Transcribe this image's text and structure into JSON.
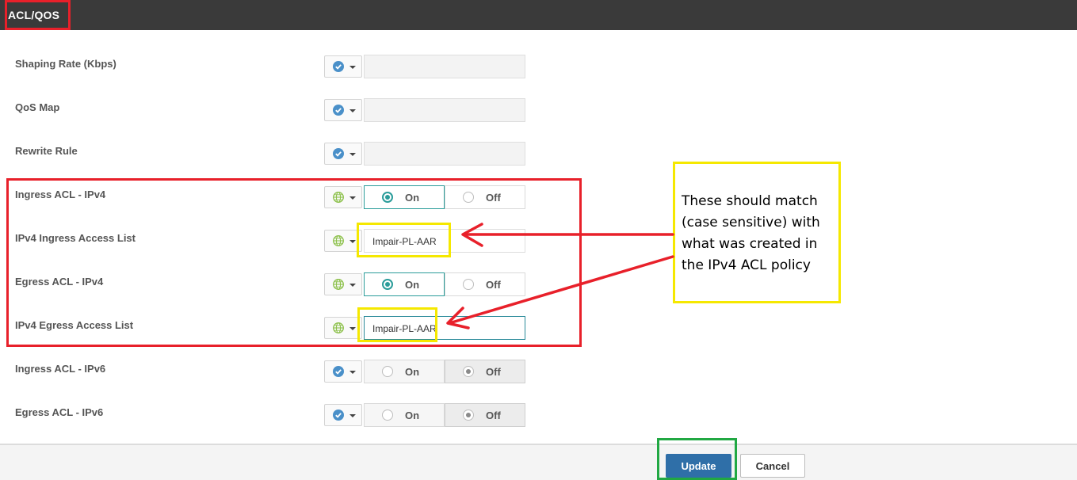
{
  "header": {
    "title": "ACL/QOS"
  },
  "rows": [
    {
      "label": "Shaping Rate (Kbps)",
      "scope_icon": "check-circle-icon"
    },
    {
      "label": "QoS Map",
      "scope_icon": "check-circle-icon"
    },
    {
      "label": "Rewrite Rule",
      "scope_icon": "check-circle-icon"
    },
    {
      "label": "Ingress ACL - IPv4",
      "scope_icon": "globe-icon",
      "on": "On",
      "off": "Off",
      "selected": "On"
    },
    {
      "label": "IPv4 Ingress Access List",
      "scope_icon": "globe-icon",
      "value": "Impair-PL-AAR"
    },
    {
      "label": "Egress ACL - IPv4",
      "scope_icon": "globe-icon",
      "on": "On",
      "off": "Off",
      "selected": "On"
    },
    {
      "label": "IPv4 Egress Access List",
      "scope_icon": "globe-icon",
      "value": "Impair-PL-AAR"
    },
    {
      "label": "Ingress ACL - IPv6",
      "scope_icon": "check-circle-icon",
      "on": "On",
      "off": "Off",
      "selected": "Off"
    },
    {
      "label": "Egress ACL - IPv6",
      "scope_icon": "check-circle-icon",
      "on": "On",
      "off": "Off",
      "selected": "Off"
    }
  ],
  "annotation": {
    "callout": "These should match (case sensitive) with what was created in the IPv4 ACL policy"
  },
  "footer": {
    "update": "Update",
    "cancel": "Cancel"
  },
  "colors": {
    "header_bg": "#3a3a3a",
    "primary_button": "#2f6fa8",
    "radio_active": "#2a9c9a",
    "annotation_red": "#e8202a",
    "annotation_yellow": "#f5e800",
    "annotation_green": "#21a843",
    "check_icon": "#4a90c9",
    "globe_icon": "#8cc04a"
  }
}
